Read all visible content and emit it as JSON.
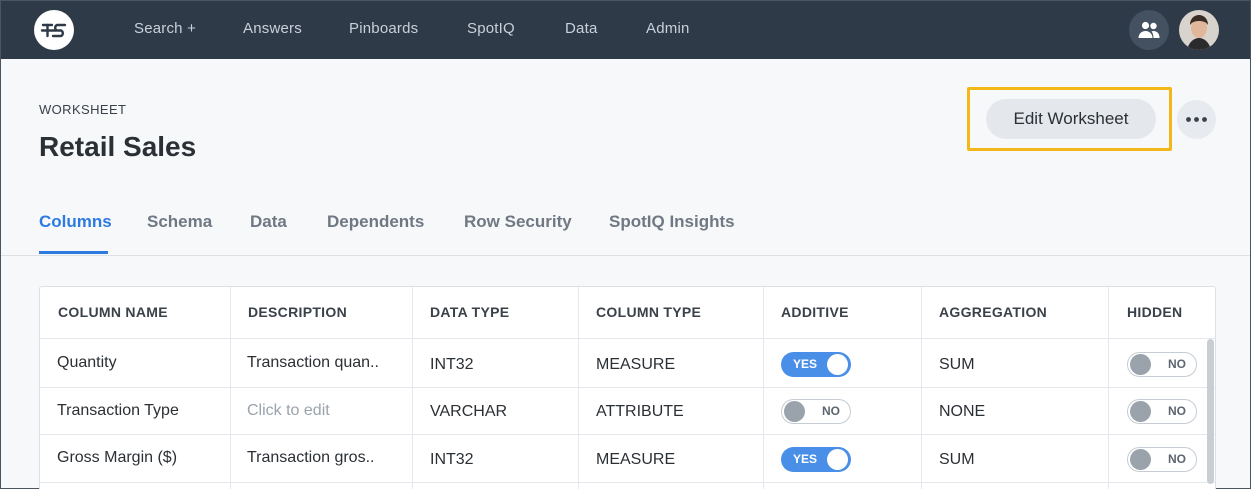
{
  "nav": {
    "items": [
      {
        "label": "Search +"
      },
      {
        "label": "Answers"
      },
      {
        "label": "Pinboards"
      },
      {
        "label": "SpotIQ"
      },
      {
        "label": "Data"
      },
      {
        "label": "Admin"
      }
    ]
  },
  "header": {
    "eyebrow": "WORKSHEET",
    "title": "Retail Sales",
    "edit_button": "Edit Worksheet"
  },
  "tabs": [
    {
      "label": "Columns",
      "active": true
    },
    {
      "label": "Schema"
    },
    {
      "label": "Data"
    },
    {
      "label": "Dependents"
    },
    {
      "label": "Row Security"
    },
    {
      "label": "SpotIQ Insights"
    }
  ],
  "table": {
    "headers": [
      "COLUMN NAME",
      "DESCRIPTION",
      "DATA TYPE",
      "COLUMN TYPE",
      "ADDITIVE",
      "AGGREGATION",
      "HIDDEN"
    ],
    "rows": [
      {
        "name": "Quantity",
        "description": "Transaction quan..",
        "data_type": "INT32",
        "column_type": "MEASURE",
        "additive": "YES",
        "aggregation": "SUM",
        "hidden": "NO"
      },
      {
        "name": "Transaction Type",
        "description": "Click to edit",
        "data_type": "VARCHAR",
        "column_type": "ATTRIBUTE",
        "additive": "NO",
        "aggregation": "NONE",
        "hidden": "NO"
      },
      {
        "name": "Gross Margin ($)",
        "description": "Transaction gros..",
        "data_type": "INT32",
        "column_type": "MEASURE",
        "additive": "YES",
        "aggregation": "SUM",
        "hidden": "NO"
      }
    ]
  },
  "colors": {
    "topbar": "#2e3a48",
    "accent": "#2d7be0",
    "highlight": "#f4b719",
    "toggle_on": "#4a8fe7"
  }
}
